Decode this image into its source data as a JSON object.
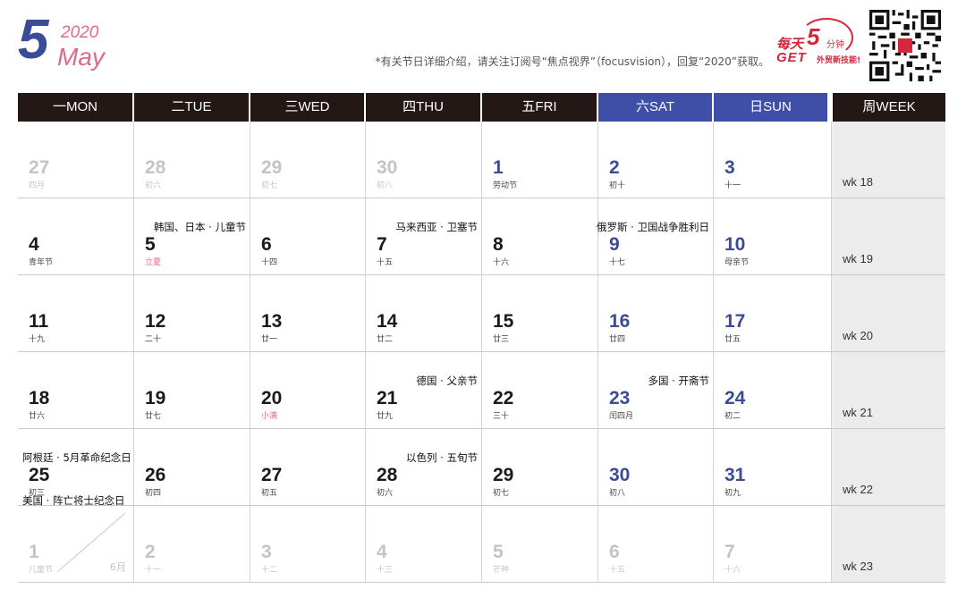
{
  "header": {
    "month_number": "5",
    "year": "2020",
    "month_name": "May",
    "note": "*有关节日详细介绍，请关注订阅号“焦点视界”（focusvision），回复“2020”获取。"
  },
  "logo": {
    "line1": "每天",
    "num": "5",
    "unit": "分钟",
    "line2": "GET",
    "tagline": "外贸新技能!"
  },
  "weekdays": [
    {
      "label": "一MON",
      "weekend": false
    },
    {
      "label": "二TUE",
      "weekend": false
    },
    {
      "label": "三WED",
      "weekend": false
    },
    {
      "label": "四THU",
      "weekend": false
    },
    {
      "label": "五FRI",
      "weekend": false
    },
    {
      "label": "六SAT",
      "weekend": true
    },
    {
      "label": "日SUN",
      "weekend": true
    },
    {
      "label": "周WEEK",
      "weekend": false
    }
  ],
  "colors": {
    "header_dark": "#231815",
    "header_weekend": "#3f4fa8",
    "accent_blue": "#3b4b97",
    "accent_pink": "#e0698a"
  },
  "weeks": [
    {
      "week": "wk 18",
      "days": [
        {
          "d": "27",
          "l": "四月",
          "style": "grey"
        },
        {
          "d": "28",
          "l": "初六",
          "style": "grey"
        },
        {
          "d": "29",
          "l": "初七",
          "style": "grey"
        },
        {
          "d": "30",
          "l": "初八",
          "style": "grey"
        },
        {
          "d": "1",
          "l": "劳动节",
          "style": "blue"
        },
        {
          "d": "2",
          "l": "初十",
          "style": "blue"
        },
        {
          "d": "3",
          "l": "十一",
          "style": "blue"
        }
      ]
    },
    {
      "week": "wk 19",
      "days": [
        {
          "d": "4",
          "l": "青年节",
          "style": ""
        },
        {
          "d": "5",
          "l": "立夏",
          "style": "",
          "lstyle": "pink",
          "h": "韩国、日本 · 儿童节"
        },
        {
          "d": "6",
          "l": "十四",
          "style": ""
        },
        {
          "d": "7",
          "l": "十五",
          "style": "",
          "h": "马来西亚 · 卫塞节"
        },
        {
          "d": "8",
          "l": "十六",
          "style": ""
        },
        {
          "d": "9",
          "l": "十七",
          "style": "blue",
          "h": "俄罗斯 · 卫国战争胜利日"
        },
        {
          "d": "10",
          "l": "母亲节",
          "style": "blue"
        }
      ]
    },
    {
      "week": "wk 20",
      "days": [
        {
          "d": "11",
          "l": "十九",
          "style": ""
        },
        {
          "d": "12",
          "l": "二十",
          "style": ""
        },
        {
          "d": "13",
          "l": "廿一",
          "style": ""
        },
        {
          "d": "14",
          "l": "廿二",
          "style": ""
        },
        {
          "d": "15",
          "l": "廿三",
          "style": ""
        },
        {
          "d": "16",
          "l": "廿四",
          "style": "blue"
        },
        {
          "d": "17",
          "l": "廿五",
          "style": "blue"
        }
      ]
    },
    {
      "week": "wk 21",
      "days": [
        {
          "d": "18",
          "l": "廿六",
          "style": ""
        },
        {
          "d": "19",
          "l": "廿七",
          "style": ""
        },
        {
          "d": "20",
          "l": "小满",
          "style": "",
          "lstyle": "pink"
        },
        {
          "d": "21",
          "l": "廿九",
          "style": "",
          "h": "德国 · 父亲节"
        },
        {
          "d": "22",
          "l": "三十",
          "style": ""
        },
        {
          "d": "23",
          "l": "闰四月",
          "style": "blue",
          "h": "多国 · 开斋节"
        },
        {
          "d": "24",
          "l": "初二",
          "style": "blue"
        }
      ]
    },
    {
      "week": "wk 22",
      "days": [
        {
          "d": "25",
          "l": "初三",
          "style": "",
          "h": "阿根廷 · 5月革命纪念日",
          "h2": "美国 · 阵亡将士纪念日"
        },
        {
          "d": "26",
          "l": "初四",
          "style": ""
        },
        {
          "d": "27",
          "l": "初五",
          "style": ""
        },
        {
          "d": "28",
          "l": "初六",
          "style": "",
          "h": "以色列 · 五旬节"
        },
        {
          "d": "29",
          "l": "初七",
          "style": ""
        },
        {
          "d": "30",
          "l": "初八",
          "style": "blue"
        },
        {
          "d": "31",
          "l": "初九",
          "style": "blue"
        }
      ]
    },
    {
      "week": "wk 23",
      "days": [
        {
          "d": "1",
          "l": "儿童节",
          "style": "grey",
          "next": "6月"
        },
        {
          "d": "2",
          "l": "十一",
          "style": "grey"
        },
        {
          "d": "3",
          "l": "十二",
          "style": "grey"
        },
        {
          "d": "4",
          "l": "十三",
          "style": "grey"
        },
        {
          "d": "5",
          "l": "芒种",
          "style": "grey"
        },
        {
          "d": "6",
          "l": "十五",
          "style": "grey"
        },
        {
          "d": "7",
          "l": "十六",
          "style": "grey"
        }
      ]
    }
  ]
}
